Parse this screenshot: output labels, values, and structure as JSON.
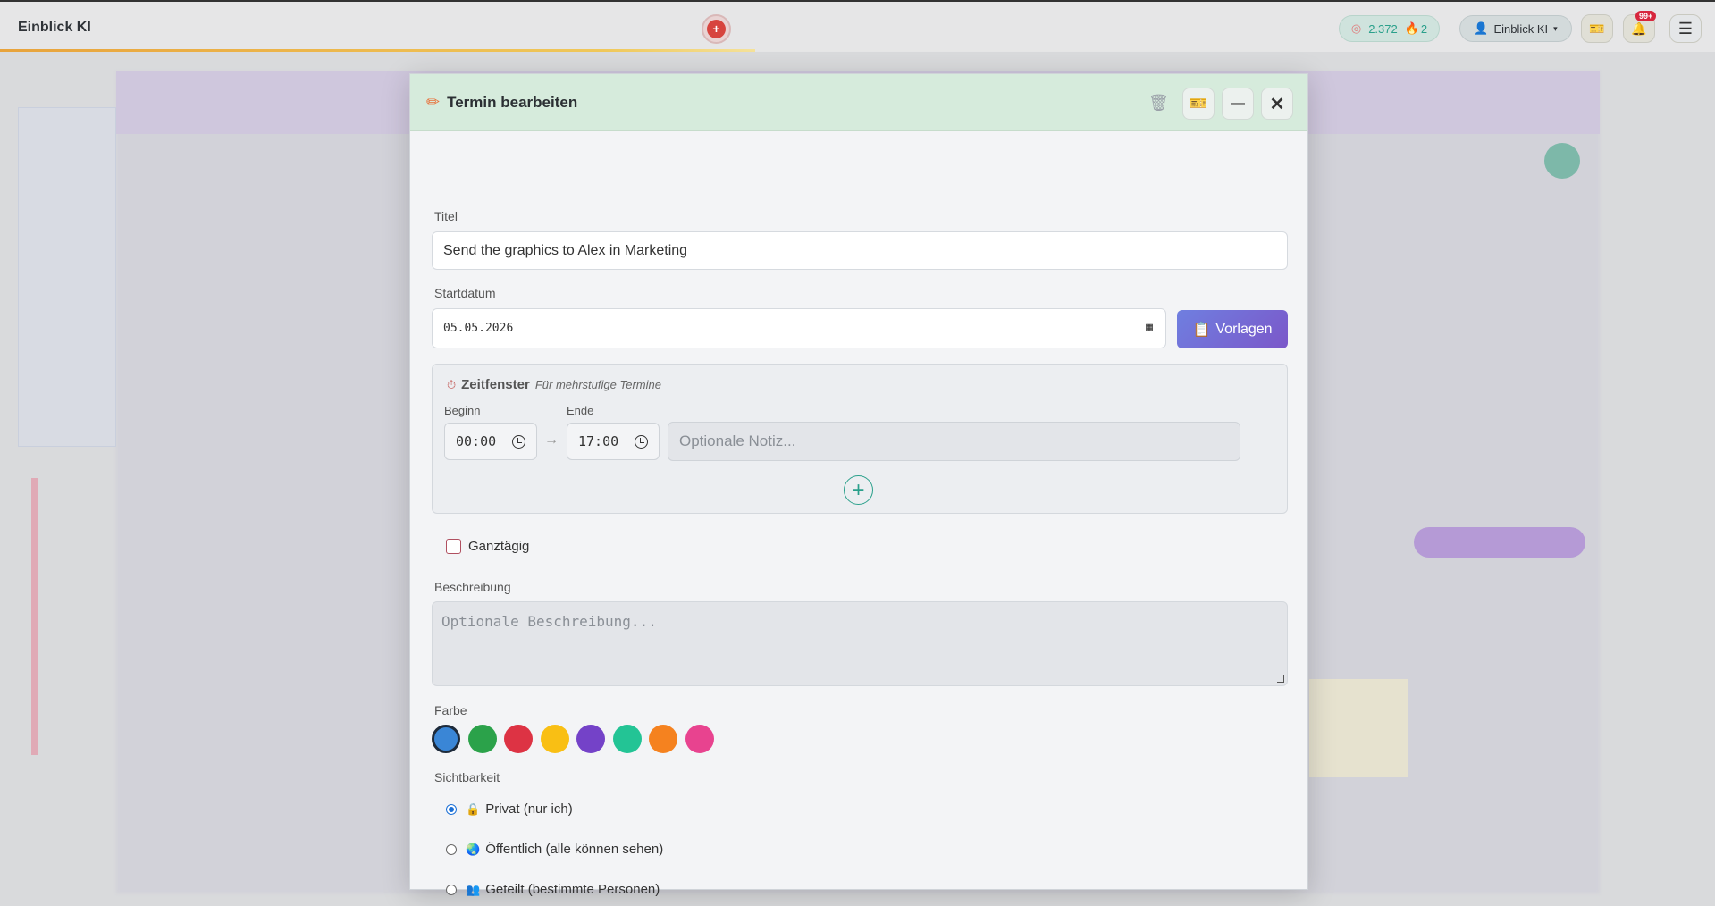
{
  "app": {
    "brand": "Einblick KI"
  },
  "topbar": {
    "stats_coins": "2.372",
    "stats_streak": "2",
    "user_label": "Einblick KI",
    "notification_badge": "99+"
  },
  "modal": {
    "title": "Termin bearbeiten",
    "title_label": "Titel",
    "title_value": "Send the graphics to Alex in Marketing",
    "start_label": "Startdatum",
    "start_value": "05.05.2026",
    "templates_label": "Vorlagen",
    "timewindow": {
      "title": "Zeitfenster",
      "subtitle": "Für mehrstufige Termine",
      "begin_label": "Beginn",
      "begin_value": "00:00",
      "end_label": "Ende",
      "end_value": "17:00",
      "note_placeholder": "Optionale Notiz..."
    },
    "allday_label": "Ganztägig",
    "description_label": "Beschreibung",
    "description_placeholder": "Optionale Beschreibung...",
    "color_label": "Farbe",
    "colors": [
      "#3a86d6",
      "#2ba24a",
      "#dd3344",
      "#f9bf14",
      "#7442c8",
      "#23c495",
      "#f5821f",
      "#e8438f"
    ],
    "visibility_label": "Sichtbarkeit",
    "visibility_options": [
      {
        "label": "Privat (nur ich)",
        "icon": "lock-icon",
        "selected": true
      },
      {
        "label": "Öffentlich (alle können sehen)",
        "icon": "globe-icon",
        "selected": false
      },
      {
        "label": "Geteilt (bestimmte Personen)",
        "icon": "people-icon",
        "selected": false
      }
    ]
  }
}
